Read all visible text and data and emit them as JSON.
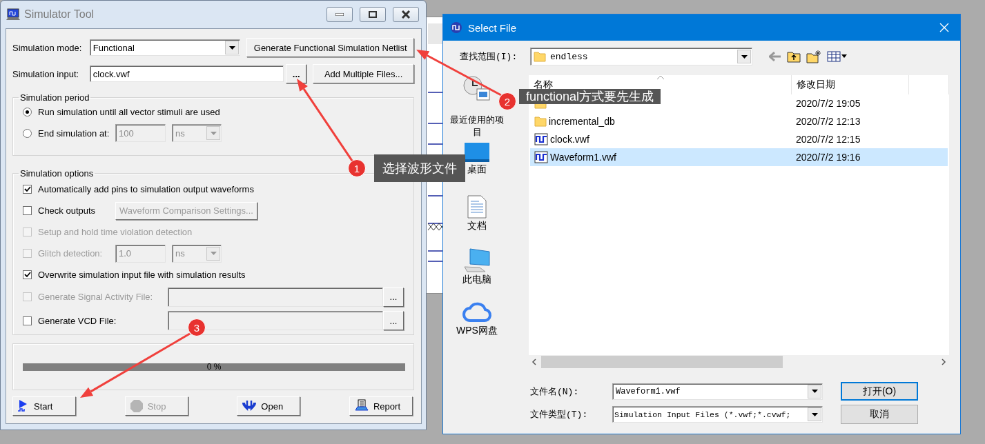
{
  "simulator": {
    "title": "Simulator Tool",
    "mode": {
      "label": "Simulation mode:",
      "value": "Functional"
    },
    "generate_button": "Generate Functional Simulation Netlist",
    "input": {
      "label": "Simulation input:",
      "value": "clock.vwf"
    },
    "browse_button": "...",
    "add_files_button": "Add Multiple Files...",
    "period": {
      "title": "Simulation period",
      "options": [
        {
          "label": "Run simulation until all vector stimuli are used",
          "selected": true
        },
        {
          "label": "End simulation at:",
          "selected": false,
          "value": "100",
          "unit": "ns",
          "disabled": true
        }
      ]
    },
    "options": {
      "title": "Simulation options",
      "items": [
        {
          "kind": "check",
          "label": "Automatically add pins to simulation output waveforms",
          "checked": true,
          "disabled": false
        },
        {
          "kind": "check_button",
          "label": "Check outputs",
          "checked": false,
          "disabled": false,
          "button": "Waveform Comparison Settings...",
          "button_disabled": true
        },
        {
          "kind": "check",
          "label": "Setup and hold time violation detection",
          "checked": false,
          "disabled": true
        },
        {
          "kind": "check_value",
          "label": "Glitch detection:",
          "checked": false,
          "disabled": true,
          "value": "1.0",
          "unit": "ns"
        },
        {
          "kind": "check",
          "label": "Overwrite simulation input file with simulation results",
          "checked": true,
          "disabled": false
        },
        {
          "kind": "check_file",
          "label": "Generate Signal Activity File:",
          "checked": false,
          "disabled": true,
          "browse": "..."
        },
        {
          "kind": "check_file",
          "label": "Generate VCD File:",
          "checked": false,
          "disabled": false,
          "browse": "..."
        }
      ]
    },
    "progress": {
      "level": 0,
      "reading": "0 %"
    },
    "buttons": [
      {
        "kind": "start",
        "label": "Start",
        "disabled": false
      },
      {
        "kind": "stop",
        "label": "Stop",
        "disabled": true
      },
      {
        "kind": "open",
        "label": "Open",
        "disabled": false
      },
      {
        "kind": "report",
        "label": "Report",
        "disabled": false
      }
    ]
  },
  "dialog": {
    "title": "Select File",
    "look_in": {
      "label": "查找范围(I):",
      "value": "endless"
    },
    "places": [
      {
        "kind": "recent",
        "label": "最近使用的项目"
      },
      {
        "kind": "desktop",
        "label": "桌面"
      },
      {
        "kind": "documents",
        "label": "文档"
      },
      {
        "kind": "computer",
        "label": "此电脑"
      },
      {
        "kind": "cloud",
        "label": "WPS网盘"
      }
    ],
    "columns": [
      "名称",
      "修改日期"
    ],
    "files": [
      {
        "kind": "folder",
        "date": "2020/7/2 19:05",
        "selected": false
      },
      {
        "kind": "folder",
        "name": "incremental_db",
        "date": "2020/7/2 12:13",
        "selected": false
      },
      {
        "kind": "waveform",
        "name": "clock.vwf",
        "date": "2020/7/2 12:15",
        "selected": false
      },
      {
        "kind": "waveform",
        "name": "Waveform1.vwf",
        "date": "2020/7/2 19:16",
        "selected": true
      }
    ],
    "file_name": {
      "label": "文件名(N):",
      "value": "Waveform1.vwf"
    },
    "file_type": {
      "label": "文件类型(T):",
      "value": "Simulation Input Files (*.vwf;*.cvwf;"
    },
    "open_button": "打开(O)",
    "cancel_button": "取消"
  },
  "annotations": [
    {
      "number": "1",
      "text": "选择波形文件"
    },
    {
      "number": "2",
      "text": "functional方式要先生成"
    },
    {
      "number": "3"
    }
  ]
}
